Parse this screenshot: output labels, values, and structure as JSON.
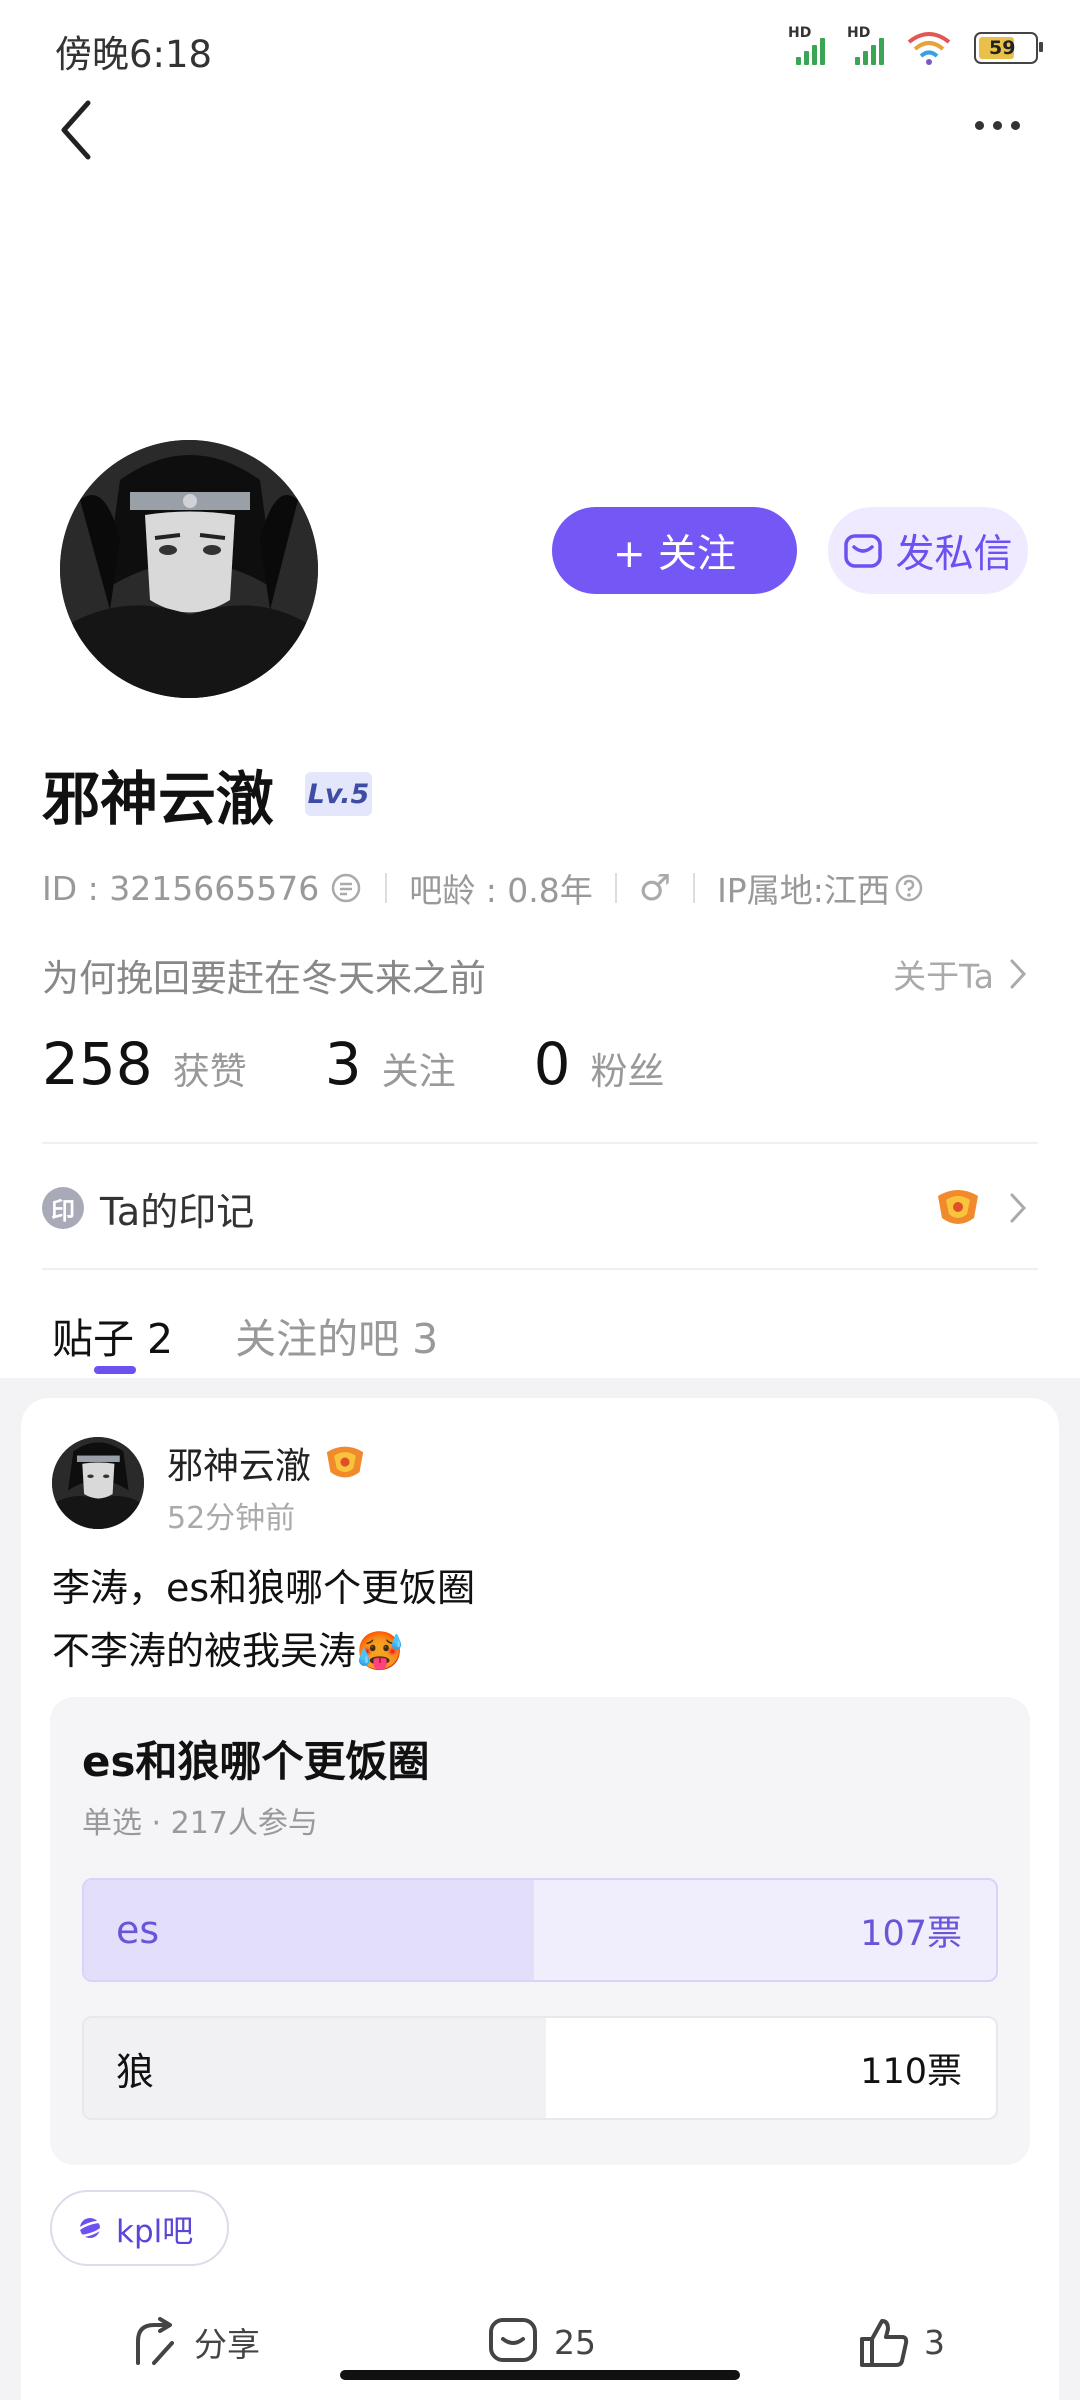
{
  "status_bar": {
    "time": "傍晚6:18",
    "battery": "59"
  },
  "profile": {
    "follow_label": "+ 关注",
    "dm_label": "发私信",
    "username": "邪神云澈",
    "level": "Lv.5",
    "id_text": "ID : 3215665576",
    "bar_age": "吧龄 : 0.8年",
    "gender_symbol": "♂",
    "ip_location": "IP属地:江西",
    "bio": "为何挽回要赶在冬天来之前",
    "about_label": "关于Ta",
    "stats": [
      {
        "value": "258",
        "label": "获赞"
      },
      {
        "value": "3",
        "label": "关注"
      },
      {
        "value": "0",
        "label": "粉丝"
      }
    ],
    "mark_label": "Ta的印记",
    "mark_badge": "印"
  },
  "tabs": [
    {
      "label": "贴子 2"
    },
    {
      "label": "关注的吧 3"
    }
  ],
  "post": {
    "author": "邪神云澈",
    "time": "52分钟前",
    "line1": "李涛，es和狼哪个更饭圈",
    "line2": "不李涛的被我吴涛🥵",
    "poll": {
      "title": "es和狼哪个更饭圈",
      "subtitle": "单选 · 217人参与",
      "options": [
        {
          "label": "es",
          "votes_text": "107票",
          "votes": 107
        },
        {
          "label": "狼",
          "votes_text": "110票",
          "votes": 110
        }
      ]
    },
    "forum_tag": "kpl吧",
    "actions": {
      "share": "分享",
      "comments": "25",
      "likes": "3"
    }
  },
  "colors": {
    "accent": "#7457f5",
    "accent_light": "#efeaff"
  }
}
